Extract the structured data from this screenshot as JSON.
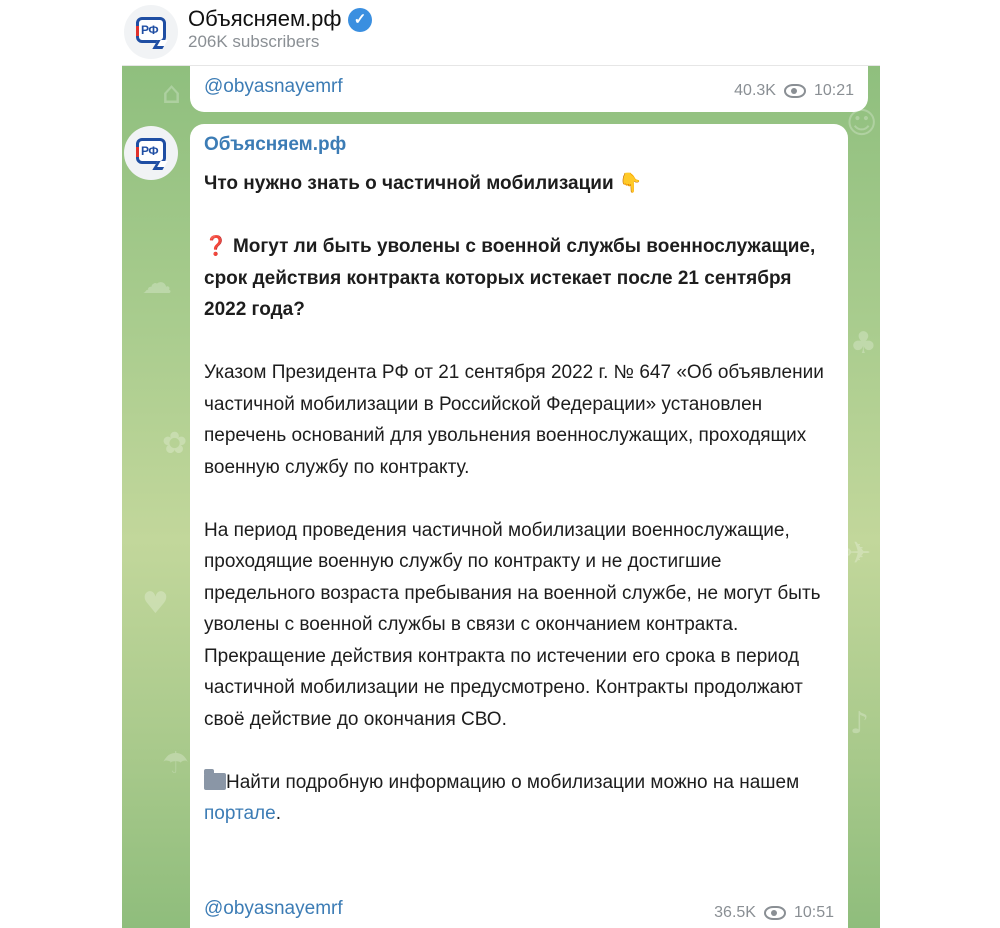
{
  "channel": {
    "name": "Объясняем.рф",
    "subscribers": "206K subscribers",
    "avatar_text": "РФ"
  },
  "prev_message": {
    "handle": "@obyasnayemrf",
    "views": "40.3K",
    "time": "10:21"
  },
  "message": {
    "sender": "Объясняем.рф",
    "title": "Что нужно знать о частичной мобилизации",
    "title_emoji": "👇",
    "question_emoji": "❓",
    "question": "Могут ли быть уволены с военной службы военнослужащие, срок действия контракта которых истекает после 21 сентября 2022 года?",
    "paragraph1": "Указом Президента РФ от 21 сентября 2022 г. № 647 «Об объявлении частичной мобилизации в Российской Федерации» установлен перечень оснований для увольнения военнослужащих, проходящих военную службу по контракту.",
    "paragraph2": "На период проведения частичной мобилизации военнослужащие, проходящие военную службу по контракту и не достигшие предельного возраста пребывания на военной службе, не могут быть уволены с военной службы в связи с окончанием контракта.",
    "paragraph3": "Прекращение действия контракта по истечении его срока в период частичной мобилизации не предусмотрено. Контракты продолжают своё действие до окончания СВО.",
    "info_text": "Найти подробную информацию о мобилизации можно на нашем ",
    "info_link": "портале",
    "info_end": ".",
    "handle": "@obyasnayemrf",
    "views": "36.5K",
    "time": "10:51"
  },
  "colors": {
    "link": "#3c7cb5",
    "verified": "#3a8fe0",
    "chat_bg": "#a9cc8e"
  },
  "icons": [
    "channel-avatar-icon",
    "verified-icon",
    "eye-icon",
    "folder-icon",
    "question-icon",
    "pointing-down-icon"
  ]
}
